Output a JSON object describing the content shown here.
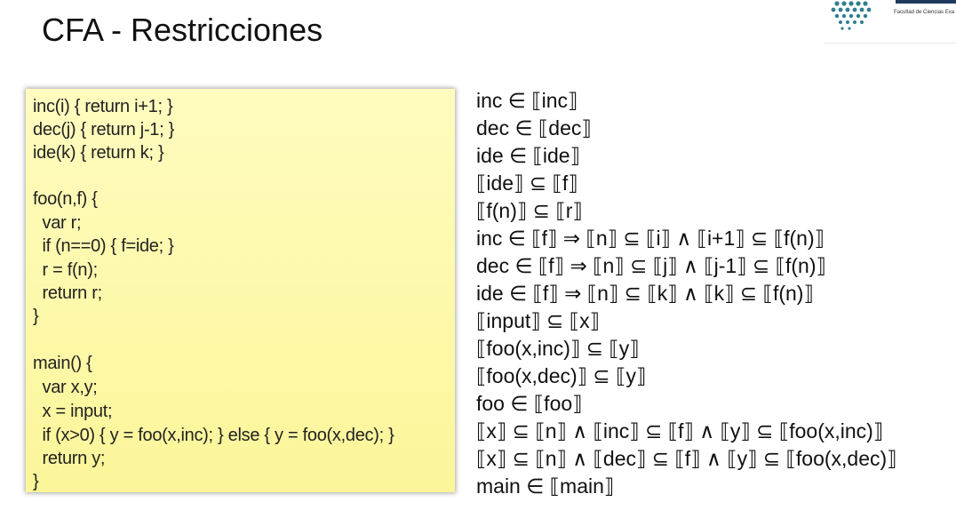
{
  "slide": {
    "title": "CFA - Restricciones"
  },
  "logo": {
    "caption": "Facultad de Ciencias Exa"
  },
  "code": [
    "inc(i) { return i+1; }",
    "dec(j) { return j-1; }",
    "ide(k) { return k; }",
    "",
    "foo(n,f) {",
    "  var r;",
    "  if (n==0) { f=ide; }",
    "  r = f(n);",
    "  return r;",
    "}",
    "",
    "main() {",
    "  var x,y;",
    "  x = input;",
    "  if (x>0) { y = foo(x,inc); } else { y = foo(x,dec); }",
    "  return y;",
    "}"
  ],
  "constraints": [
    "inc ∈ ⟦inc⟧",
    "dec ∈ ⟦dec⟧",
    "ide ∈ ⟦ide⟧",
    "⟦ide⟧ ⊆ ⟦f⟧",
    "⟦f(n)⟧ ⊆ ⟦r⟧",
    "inc ∈ ⟦f⟧ ⇒ ⟦n⟧ ⊆ ⟦i⟧ ∧ ⟦i+1⟧ ⊆ ⟦f(n)⟧",
    "dec ∈ ⟦f⟧ ⇒ ⟦n⟧ ⊆ ⟦j⟧ ∧ ⟦j-1⟧ ⊆ ⟦f(n)⟧",
    "ide ∈ ⟦f⟧ ⇒ ⟦n⟧ ⊆ ⟦k⟧ ∧ ⟦k⟧ ⊆ ⟦f(n)⟧",
    "⟦input⟧ ⊆ ⟦x⟧",
    "⟦foo(x,inc)⟧ ⊆ ⟦y⟧",
    "⟦foo(x,dec)⟧ ⊆ ⟦y⟧",
    "foo ∈ ⟦foo⟧",
    "⟦x⟧ ⊆ ⟦n⟧ ∧ ⟦inc⟧ ⊆ ⟦f⟧ ∧ ⟦y⟧ ⊆ ⟦foo(x,inc)⟧",
    "⟦x⟧ ⊆ ⟦n⟧ ∧ ⟦dec⟧ ⊆ ⟦f⟧ ∧ ⟦y⟧ ⊆ ⟦foo(x,dec)⟧",
    "main ∈ ⟦main⟧"
  ],
  "colors": {
    "code_box_top": "#fffcbf",
    "code_box_bottom": "#fbf699",
    "logo_dot": "#2f7f8f"
  }
}
